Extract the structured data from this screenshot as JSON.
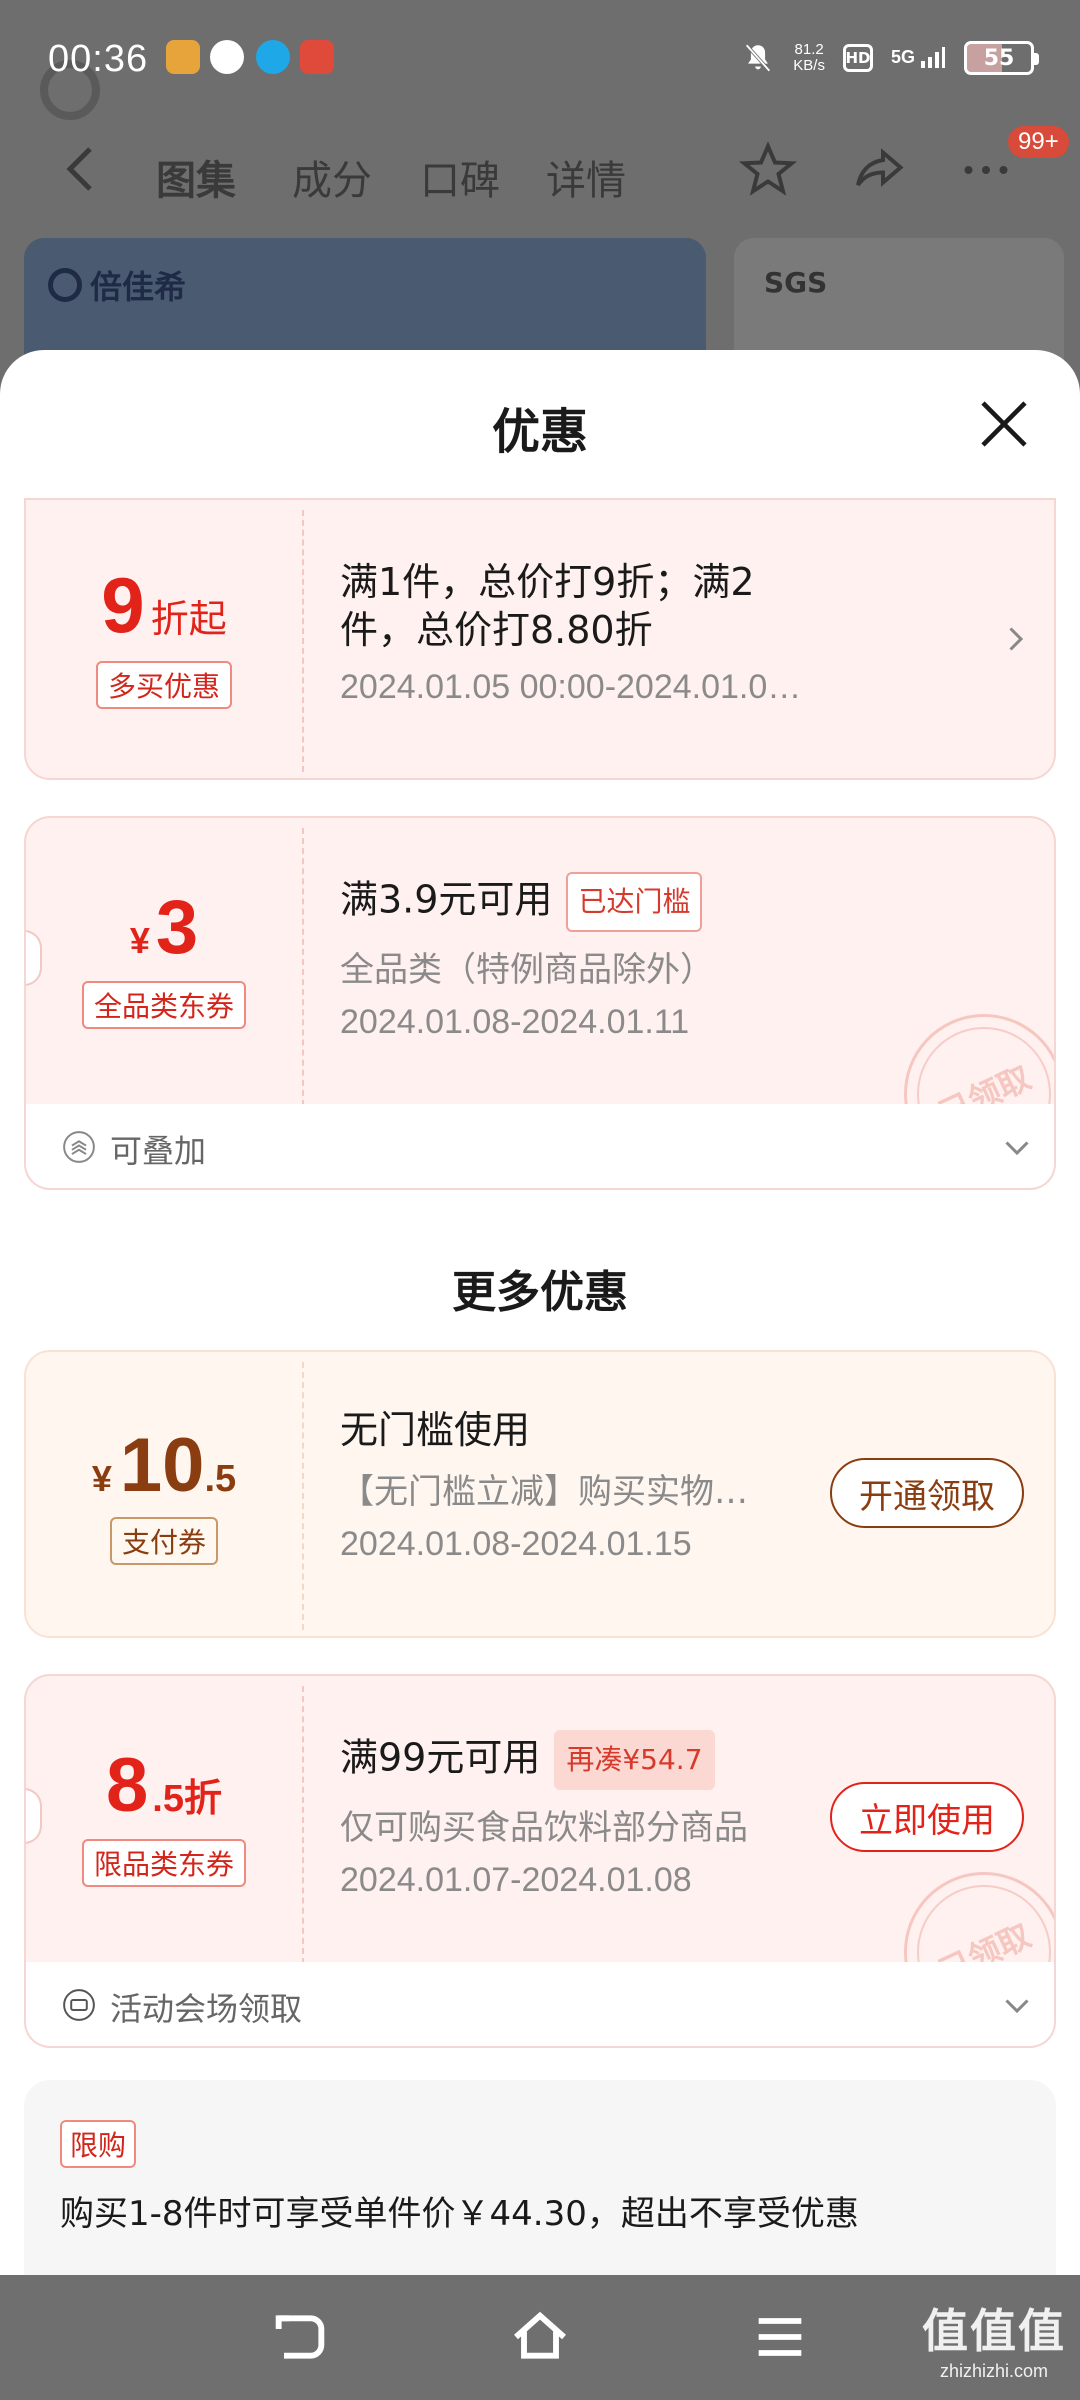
{
  "status_bar": {
    "time": "00:36",
    "net_speed_value": "81.2",
    "net_speed_unit": "KB/s",
    "hd": "HD",
    "network": "5G",
    "battery": "55"
  },
  "background_page": {
    "tabs": [
      "图集",
      "成分",
      "口碑",
      "详情"
    ],
    "badge": "99+",
    "brand": "倍佳希",
    "card_right_text": "SGS"
  },
  "sheet": {
    "title": "优惠",
    "more_title": "更多优惠"
  },
  "coupons": [
    {
      "amount_main": "9",
      "amount_suffix": "折起",
      "tag": "多买优惠",
      "line1": "满1件，总价打9折；满2",
      "line1b": "件，总价打8.80折",
      "line3": "2024.01.05 00:00-2024.01.0…"
    },
    {
      "currency": "¥",
      "amount_main": "3",
      "tag": "全品类东券",
      "line1": "满3.9元可用",
      "badge": "已达门槛",
      "line2": "全品类（特例商品除外）",
      "line3": "2024.01.08-2024.01.11",
      "stamp": "已领取",
      "footer": "可叠加"
    },
    {
      "currency": "¥",
      "amount_main": "10",
      "amount_suffix": ".5",
      "tag": "支付券",
      "line1": "无门槛使用",
      "line2": "【无门槛立减】购买实物…",
      "line3": "2024.01.08-2024.01.15",
      "button": "开通领取"
    },
    {
      "amount_main": "8",
      "amount_suffix": ".5折",
      "tag": "限品类东券",
      "line1": "满99元可用",
      "badge": "再凑¥54.7",
      "line2": "仅可购买食品饮料部分商品",
      "line3": "2024.01.07-2024.01.08",
      "button": "立即使用",
      "stamp": "已领取",
      "footer": "活动会场领取"
    }
  ],
  "limit": {
    "tag": "限购",
    "text": "购买1-8件时可享受单件价￥44.30，超出不享受优惠"
  },
  "watermark": {
    "big": "值值值",
    "small": "zhizhizhi.com"
  }
}
